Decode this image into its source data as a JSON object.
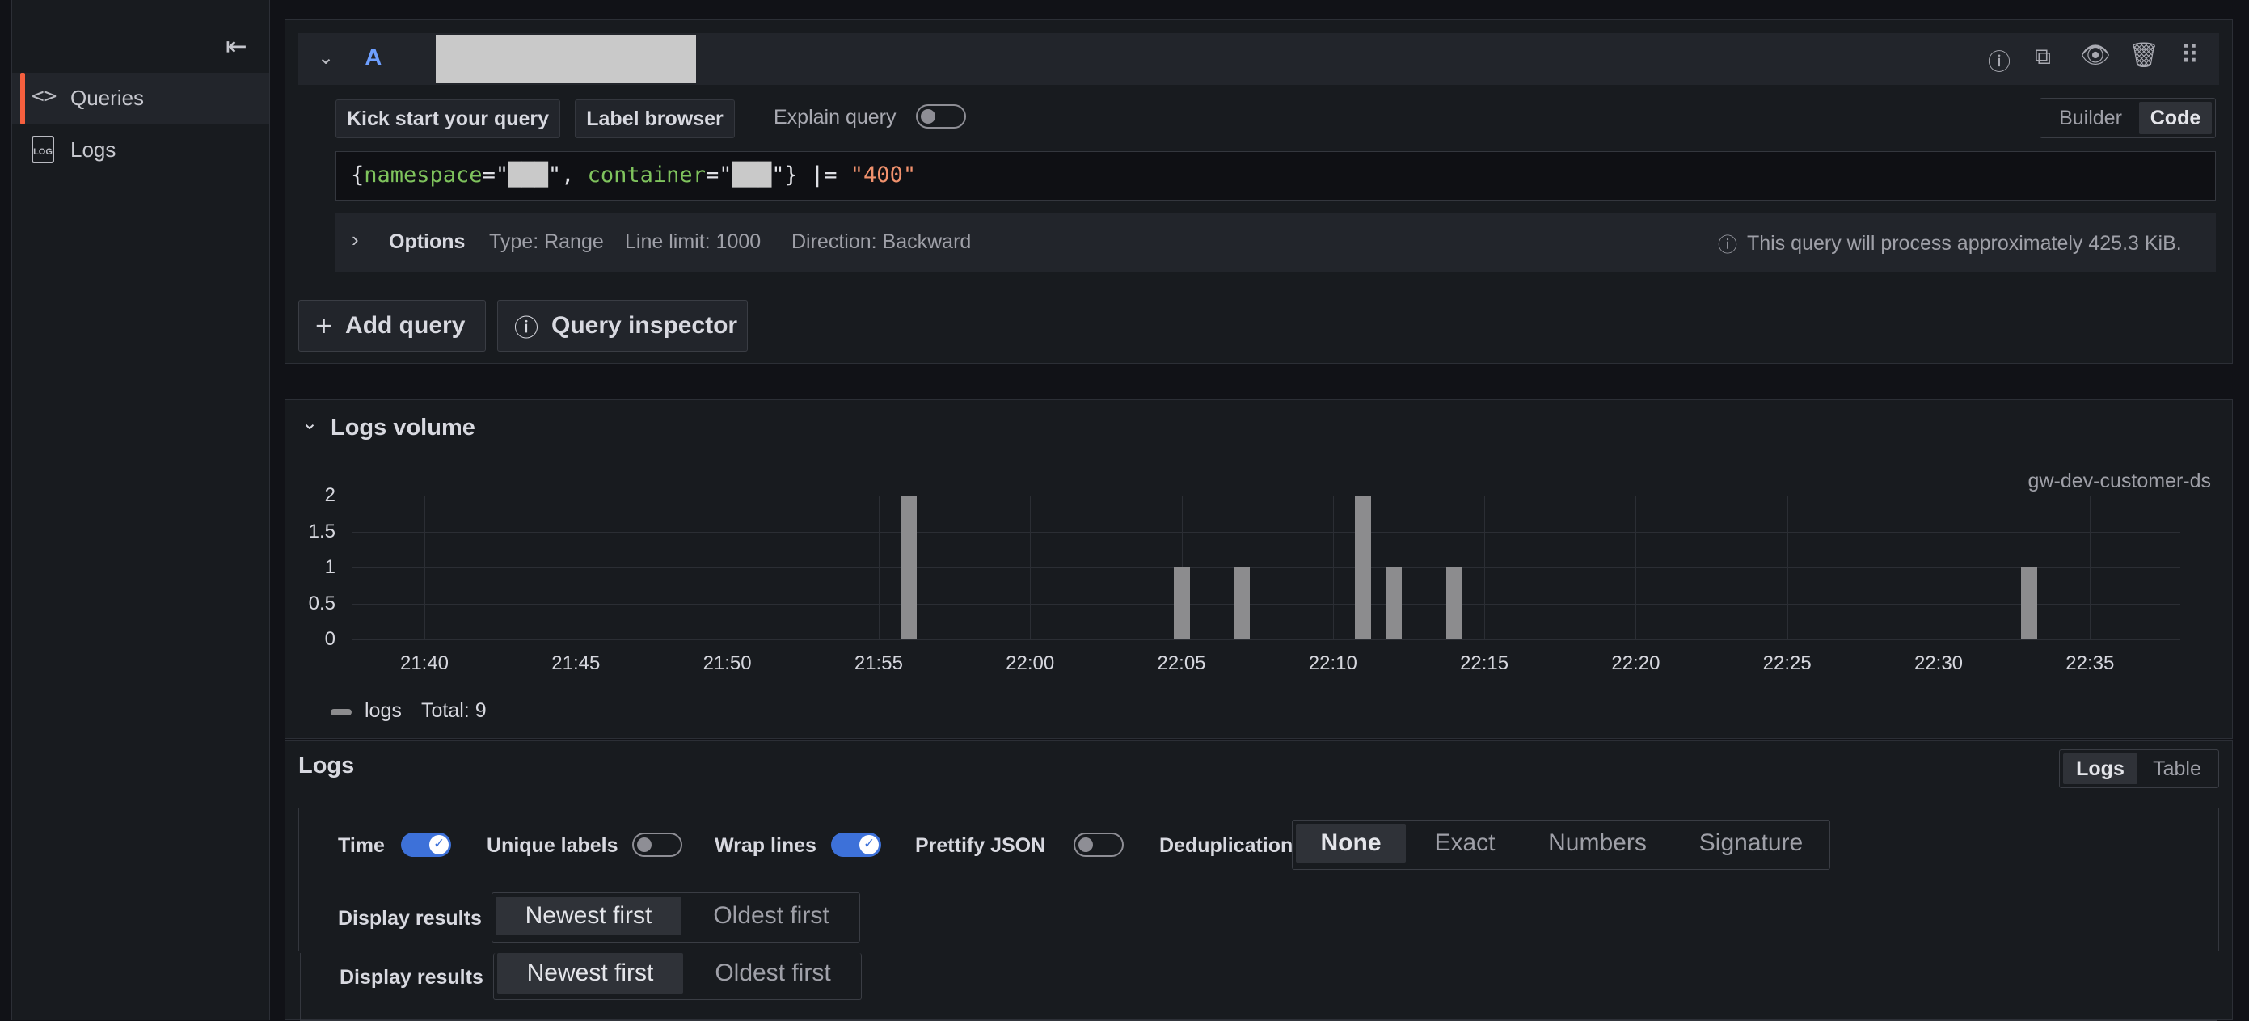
{
  "sidebar": {
    "items": [
      {
        "label": "Queries",
        "icon": "code-icon",
        "active": true
      },
      {
        "label": "Logs",
        "icon": "log-file-icon",
        "active": false
      }
    ]
  },
  "query": {
    "ref_id": "A",
    "kick_start_label": "Kick start your query",
    "label_browser_label": "Label browser",
    "explain_query_label": "Explain query",
    "mode_builder": "Builder",
    "mode_code": "Code",
    "code": {
      "open": "{",
      "key1": "namespace",
      "eq1": "=\"",
      "val1": "███",
      "close1": "\",",
      "key2": " container",
      "eq2": "=\"",
      "val2": "███",
      "close2": "\"}",
      "op": " |= ",
      "str": "\"400\""
    },
    "options": {
      "label": "Options",
      "type": "Type: Range",
      "line_limit": "Line limit: 1000",
      "direction": "Direction: Backward",
      "process_info": "This query will process approximately 425.3 KiB."
    }
  },
  "actions": {
    "add_query": "Add query",
    "query_inspector": "Query inspector"
  },
  "volume": {
    "title": "Logs volume",
    "datasource": "gw-dev-customer-ds",
    "legend_name": "logs",
    "legend_total": "Total: 9",
    "series_color": "#8c8c8e"
  },
  "chart_data": {
    "type": "bar",
    "title": "Logs volume",
    "xlabel": "",
    "ylabel": "",
    "ylim": [
      0,
      2
    ],
    "yticks": [
      "0",
      "0.5",
      "1",
      "1.5",
      "2"
    ],
    "xticks": [
      "21:40",
      "21:45",
      "21:50",
      "21:55",
      "22:00",
      "22:05",
      "22:10",
      "22:15",
      "22:20",
      "22:25",
      "22:30",
      "22:35"
    ],
    "series": [
      {
        "name": "logs",
        "points": [
          {
            "x": "21:56",
            "y": 2
          },
          {
            "x": "22:05",
            "y": 1
          },
          {
            "x": "22:07",
            "y": 1
          },
          {
            "x": "22:11",
            "y": 2
          },
          {
            "x": "22:12",
            "y": 1
          },
          {
            "x": "22:14",
            "y": 1
          },
          {
            "x": "22:33",
            "y": 1
          }
        ]
      }
    ],
    "legend": "bottom-left",
    "grid": true
  },
  "logs": {
    "title": "Logs",
    "view_logs": "Logs",
    "view_table": "Table",
    "time_label": "Time",
    "unique_labels_label": "Unique labels",
    "wrap_lines_label": "Wrap lines",
    "prettify_json_label": "Prettify JSON",
    "dedup_label": "Deduplication",
    "dedup_options": [
      "None",
      "Exact",
      "Numbers",
      "Signature"
    ],
    "display_results_label": "Display results",
    "order_options": [
      "Newest first",
      "Oldest first"
    ],
    "accent_color": "#3d71d9"
  }
}
